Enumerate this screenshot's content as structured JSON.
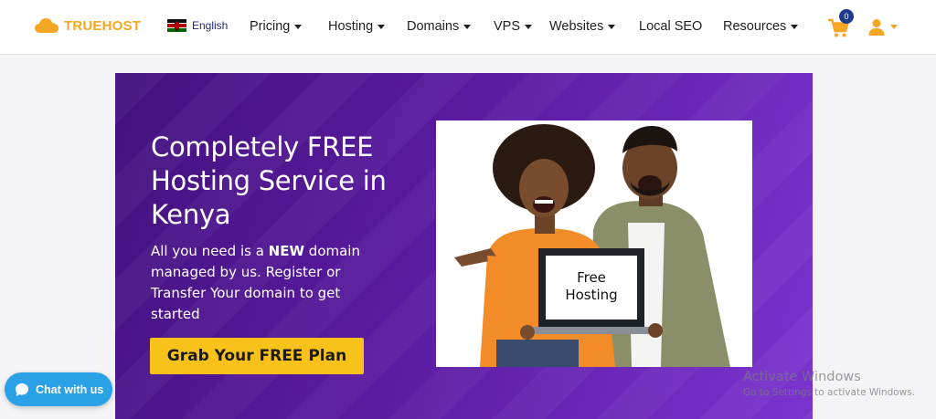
{
  "brand": {
    "name": "TRUEHOST",
    "color": "#f5a623"
  },
  "language": {
    "label": "English",
    "flag_icon": "kenya-flag"
  },
  "nav": {
    "items": [
      {
        "label": "Pricing",
        "has_dropdown": true
      },
      {
        "label": "Hosting",
        "has_dropdown": true
      },
      {
        "label": "Domains",
        "has_dropdown": true
      },
      {
        "label": "VPS",
        "has_dropdown": true
      },
      {
        "label": "Websites",
        "has_dropdown": true
      },
      {
        "label": "Local SEO",
        "has_dropdown": false
      },
      {
        "label": "Resources",
        "has_dropdown": true
      }
    ]
  },
  "cart": {
    "count": "0",
    "icon": "cart-icon"
  },
  "user": {
    "icon": "user-icon"
  },
  "hero": {
    "title": "Completely FREE Hosting Service in Kenya",
    "description_prefix": "All you need is a ",
    "description_bold": "NEW",
    "description_suffix": " domain managed by us. Register or Transfer Your domain to get started",
    "cta_label": "Grab Your FREE Plan",
    "laptop_text_line1": "Free",
    "laptop_text_line2": "Hosting",
    "colors": {
      "gradient_start": "#43127e",
      "gradient_end": "#7b34cf",
      "cta": "#f9c21b"
    }
  },
  "chat": {
    "label": "Chat with us",
    "color": "#2aa1e6"
  },
  "watermark": {
    "title": "Activate Windows",
    "subtitle": "Go to Settings to activate Windows."
  }
}
